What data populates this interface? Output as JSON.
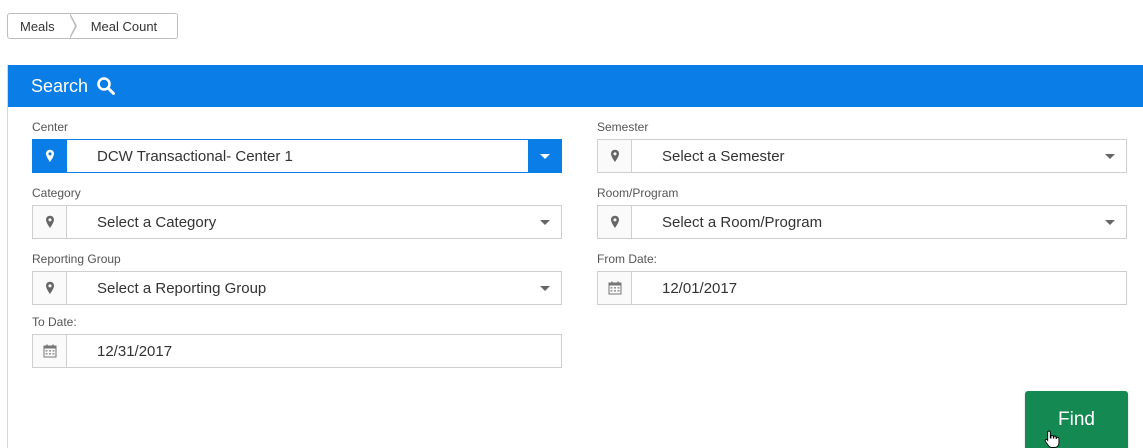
{
  "breadcrumb": {
    "items": [
      "Meals",
      "Meal Count"
    ]
  },
  "panel": {
    "title": "Search"
  },
  "fields": {
    "center": {
      "label": "Center",
      "value": "DCW Transactional- Center 1"
    },
    "semester": {
      "label": "Semester",
      "value": "Select a Semester"
    },
    "category": {
      "label": "Category",
      "value": "Select a Category"
    },
    "room_program": {
      "label": "Room/Program",
      "value": "Select a Room/Program"
    },
    "reporting_group": {
      "label": "Reporting Group",
      "value": "Select a Reporting Group"
    },
    "from_date": {
      "label": "From Date:",
      "value": "12/01/2017"
    },
    "to_date": {
      "label": "To Date:",
      "value": "12/31/2017"
    }
  },
  "actions": {
    "find_label": "Find"
  },
  "colors": {
    "header": "#0a7de6",
    "find": "#148a52",
    "active": "#0a7de6"
  },
  "icons": [
    "search-icon",
    "map-marker-icon",
    "calendar-icon",
    "caret-down-icon"
  ]
}
